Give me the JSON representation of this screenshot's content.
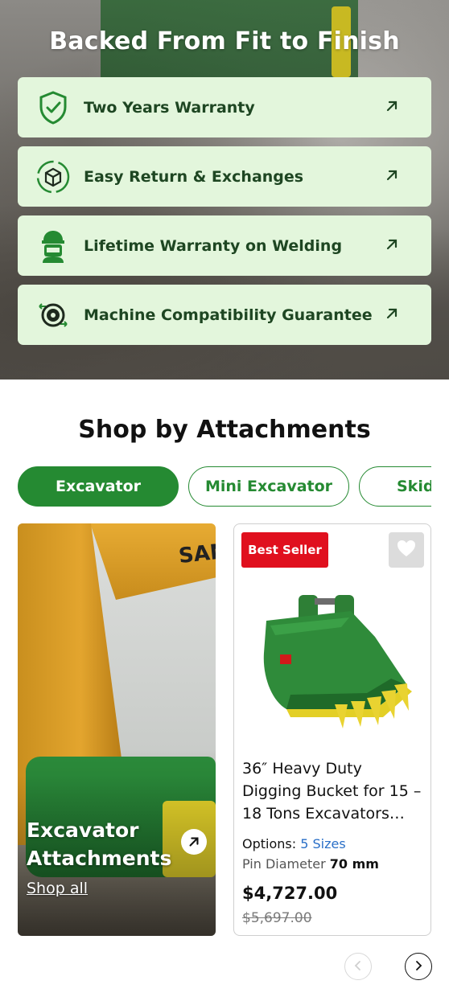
{
  "hero": {
    "title": "Backed From Fit to Finish",
    "benefits": [
      {
        "label": "Two Years Warranty",
        "icon": "shield-check-icon"
      },
      {
        "label": "Easy Return & Exchanges",
        "icon": "box-return-icon"
      },
      {
        "label": "Lifetime Warranty on Welding",
        "icon": "welder-icon"
      },
      {
        "label": "Machine Compatibility Guarantee",
        "icon": "gear-arrows-icon"
      }
    ],
    "arrow_icon": "arrow-up-right-icon"
  },
  "shop": {
    "title": "Shop by Attachments",
    "tabs": [
      {
        "label": "Excavator",
        "active": true
      },
      {
        "label": "Mini Excavator",
        "active": false
      },
      {
        "label": "Skid",
        "active": false
      }
    ],
    "promo": {
      "brand": "SANY",
      "title": "Excavator Attachments",
      "link": "Shop all"
    },
    "product": {
      "badge": "Best Seller",
      "title": "36″ Heavy Duty Digging Bucket for 15 – 18 Tons Excavators…",
      "options_label": "Options:",
      "options_value": "5 Sizes",
      "pin_label": "Pin Diameter",
      "pin_value": "70 mm",
      "price": "$4,727.00",
      "old_price": "$5,697.00"
    }
  },
  "colors": {
    "brand_green": "#258a32",
    "benefit_bg": "#e3f6dc",
    "badge_red": "#e0101e",
    "link_blue": "#2a6fc7"
  }
}
